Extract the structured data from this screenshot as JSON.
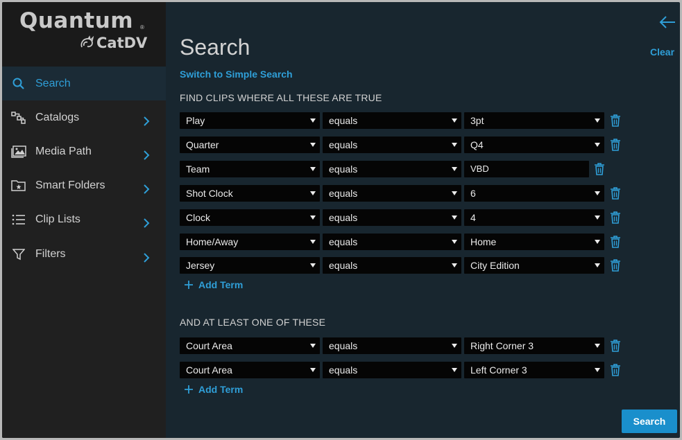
{
  "brand": {
    "company": "Quantum",
    "registered": "®",
    "product": "CatDV"
  },
  "sidebar": {
    "items": [
      {
        "label": "Search",
        "icon": "search-icon",
        "active": true
      },
      {
        "label": "Catalogs",
        "icon": "catalogs-icon"
      },
      {
        "label": "Media Path",
        "icon": "media-path-icon"
      },
      {
        "label": "Smart Folders",
        "icon": "smart-folder-icon"
      },
      {
        "label": "Clip Lists",
        "icon": "list-icon"
      },
      {
        "label": "Filters",
        "icon": "filter-icon"
      }
    ]
  },
  "header": {
    "title": "Search",
    "clear_label": "Clear",
    "switch_label": "Switch to Simple Search"
  },
  "all_section": {
    "heading": "FIND CLIPS WHERE ALL THESE ARE TRUE",
    "terms": [
      {
        "field": "Play",
        "op": "equals",
        "value": "3pt"
      },
      {
        "field": "Quarter",
        "op": "equals",
        "value": "Q4"
      },
      {
        "field": "Team",
        "op": "equals",
        "value": "VBD"
      },
      {
        "field": "Shot Clock",
        "op": "equals",
        "value": "6"
      },
      {
        "field": "Clock",
        "op": "equals",
        "value": "4"
      },
      {
        "field": "Home/Away",
        "op": "equals",
        "value": "Home"
      },
      {
        "field": "Jersey",
        "op": "equals",
        "value": "City Edition"
      }
    ],
    "add_label": "Add Term"
  },
  "any_section": {
    "heading": "AND AT LEAST ONE OF THESE",
    "terms": [
      {
        "field": "Court Area",
        "op": "equals",
        "value": "Right Corner 3"
      },
      {
        "field": "Court Area",
        "op": "equals",
        "value": "Left Corner 3"
      }
    ],
    "add_label": "Add Term"
  },
  "footer": {
    "search_label": "Search"
  },
  "colors": {
    "accent": "#2f9fd8",
    "sidebar_bg": "#202020",
    "main_bg": "#18262f",
    "input_bg": "#050505",
    "button_bg": "#1a8fcc"
  }
}
